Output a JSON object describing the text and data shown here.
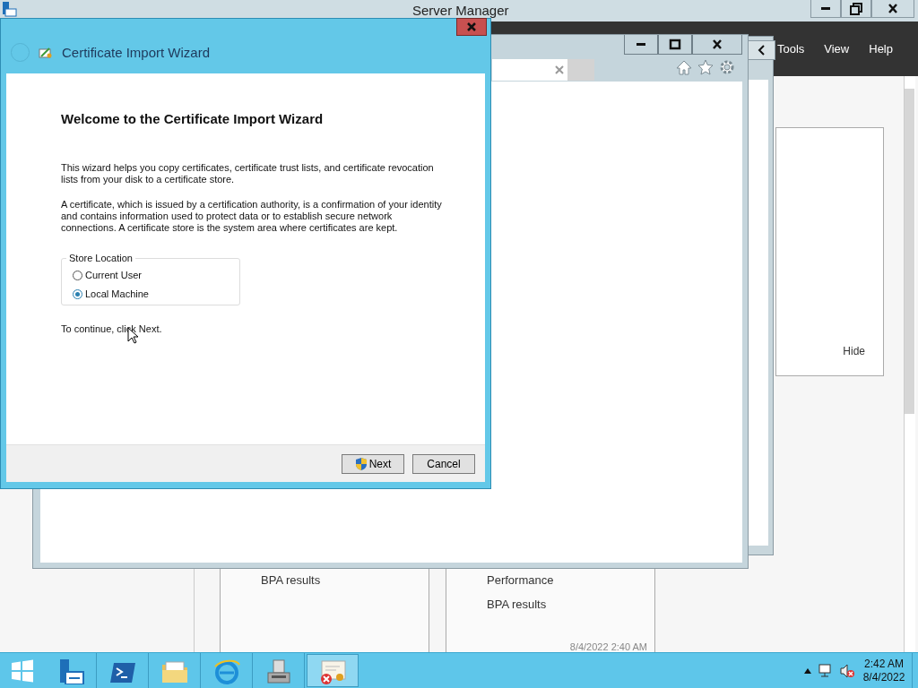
{
  "server_manager": {
    "title": "Server Manager",
    "menu": [
      "Tools",
      "View",
      "Help"
    ],
    "panel": {
      "link": "Hide"
    },
    "tiles": [
      {
        "items": [
          "BPA results"
        ]
      },
      {
        "items": [
          "Performance",
          "BPA results"
        ],
        "timestamp": "8/4/2022 2:40 AM"
      }
    ]
  },
  "wizard": {
    "title": "Certificate Import Wizard",
    "heading": "Welcome to the Certificate Import Wizard",
    "paragraphs": [
      "This wizard helps you copy certificates, certificate trust lists, and certificate revocation lists from your disk to a certificate store.",
      "A certificate, which is issued by a certification authority, is a confirmation of your identity and contains information used to protect data or to establish secure network connections. A certificate store is the system area where certificates are kept."
    ],
    "group": {
      "label": "Store Location",
      "options": [
        {
          "label": "Current User",
          "selected": false
        },
        {
          "label": "Local Machine",
          "selected": true
        }
      ]
    },
    "hint": "To continue, click Next.",
    "buttons": [
      {
        "label": "Next",
        "kind": "shield"
      },
      {
        "label": "Cancel",
        "kind": "plain"
      }
    ]
  },
  "taskbar": {
    "apps": [
      {
        "kind": "server",
        "selected": false
      },
      {
        "kind": "powershell",
        "selected": false
      },
      {
        "kind": "folder",
        "selected": false
      },
      {
        "kind": "browser",
        "selected": false
      },
      {
        "kind": "tool",
        "selected": false
      },
      {
        "kind": "certificate",
        "selected": true
      }
    ],
    "time": "2:42 AM",
    "date": "8/4/2022"
  }
}
